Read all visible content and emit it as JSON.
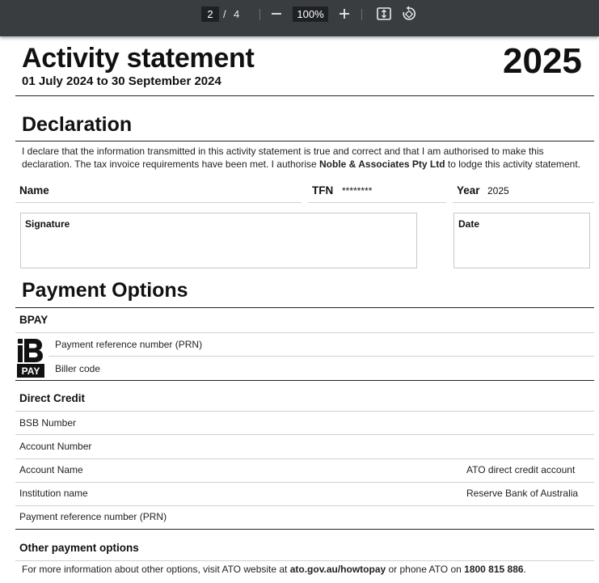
{
  "toolbar": {
    "current_page": "2",
    "page_separator": "/",
    "total_pages": "4",
    "zoom_level": "100%"
  },
  "statement": {
    "title": "Activity statement",
    "period": "01 July 2024 to 30 September 2024",
    "year": "2025"
  },
  "declaration": {
    "heading": "Declaration",
    "text_part1": "I declare that the information transmitted in this activity statement is true and correct and that I am authorised to make this declaration. The tax invoice requirements have been met. I authorise ",
    "agent_name": "Noble & Associates Pty Ltd",
    "text_part2": " to lodge this activity statement.",
    "name_label": "Name",
    "name_value": "",
    "tfn_label": "TFN",
    "tfn_value": "********",
    "year_label": "Year",
    "year_value": "2025",
    "signature_label": "Signature",
    "date_label": "Date"
  },
  "payment": {
    "heading": "Payment Options",
    "bpay": {
      "heading": "BPAY",
      "logo_text": "PAY",
      "rows": [
        "Payment reference number (PRN)",
        "Biller code"
      ]
    },
    "direct_credit": {
      "heading": "Direct Credit",
      "rows": [
        {
          "label": "BSB Number",
          "value": ""
        },
        {
          "label": "Account Number",
          "value": ""
        },
        {
          "label": "Account Name",
          "value": "ATO direct credit account"
        },
        {
          "label": "Institution name",
          "value": "Reserve Bank of Australia"
        },
        {
          "label": "Payment reference number (PRN)",
          "value": ""
        }
      ]
    },
    "other": {
      "heading": "Other payment options",
      "text_part1": "For more information about other options, visit ATO website at ",
      "website": "ato.gov.au/howtopay",
      "text_part2": " or phone ATO on ",
      "phone": "1800 815 886",
      "text_part3": "."
    }
  },
  "colors": {
    "toolbar_bg": "#3a3d40",
    "toolbar_field_bg": "#1f2023",
    "text": "#111111"
  }
}
